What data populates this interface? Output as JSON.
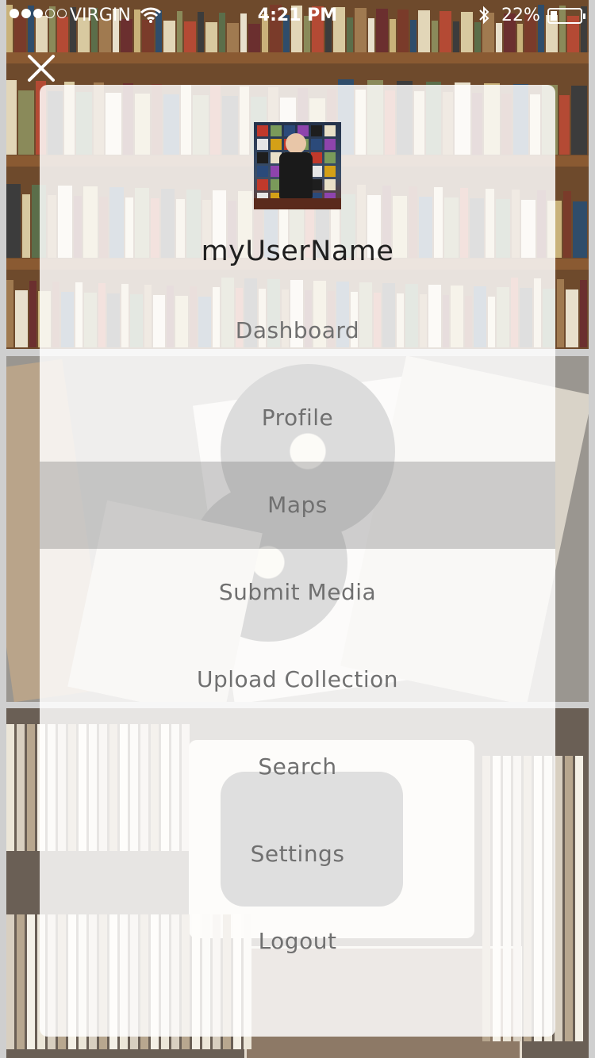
{
  "status_bar": {
    "carrier": "VIRGIN",
    "time": "4:21 PM",
    "battery_percent_label": "22%",
    "battery_level": 0.22,
    "signal_bars": 3,
    "signal_total": 5
  },
  "profile": {
    "username": "myUserName"
  },
  "menu": {
    "items": [
      {
        "label": "Dashboard"
      },
      {
        "label": "Profile"
      },
      {
        "label": "Maps",
        "active": true
      },
      {
        "label": "Submit Media"
      },
      {
        "label": "Upload Collection"
      },
      {
        "label": "Search"
      },
      {
        "label": "Settings"
      },
      {
        "label": "Logout"
      }
    ]
  },
  "icons": {
    "close": "close-icon",
    "wifi": "wifi-icon",
    "bluetooth": "bluetooth-icon",
    "battery": "battery-icon"
  },
  "colors": {
    "menu_text": "#707070",
    "username_text": "#1f1f1f",
    "active_row": "#9a9a9a"
  }
}
